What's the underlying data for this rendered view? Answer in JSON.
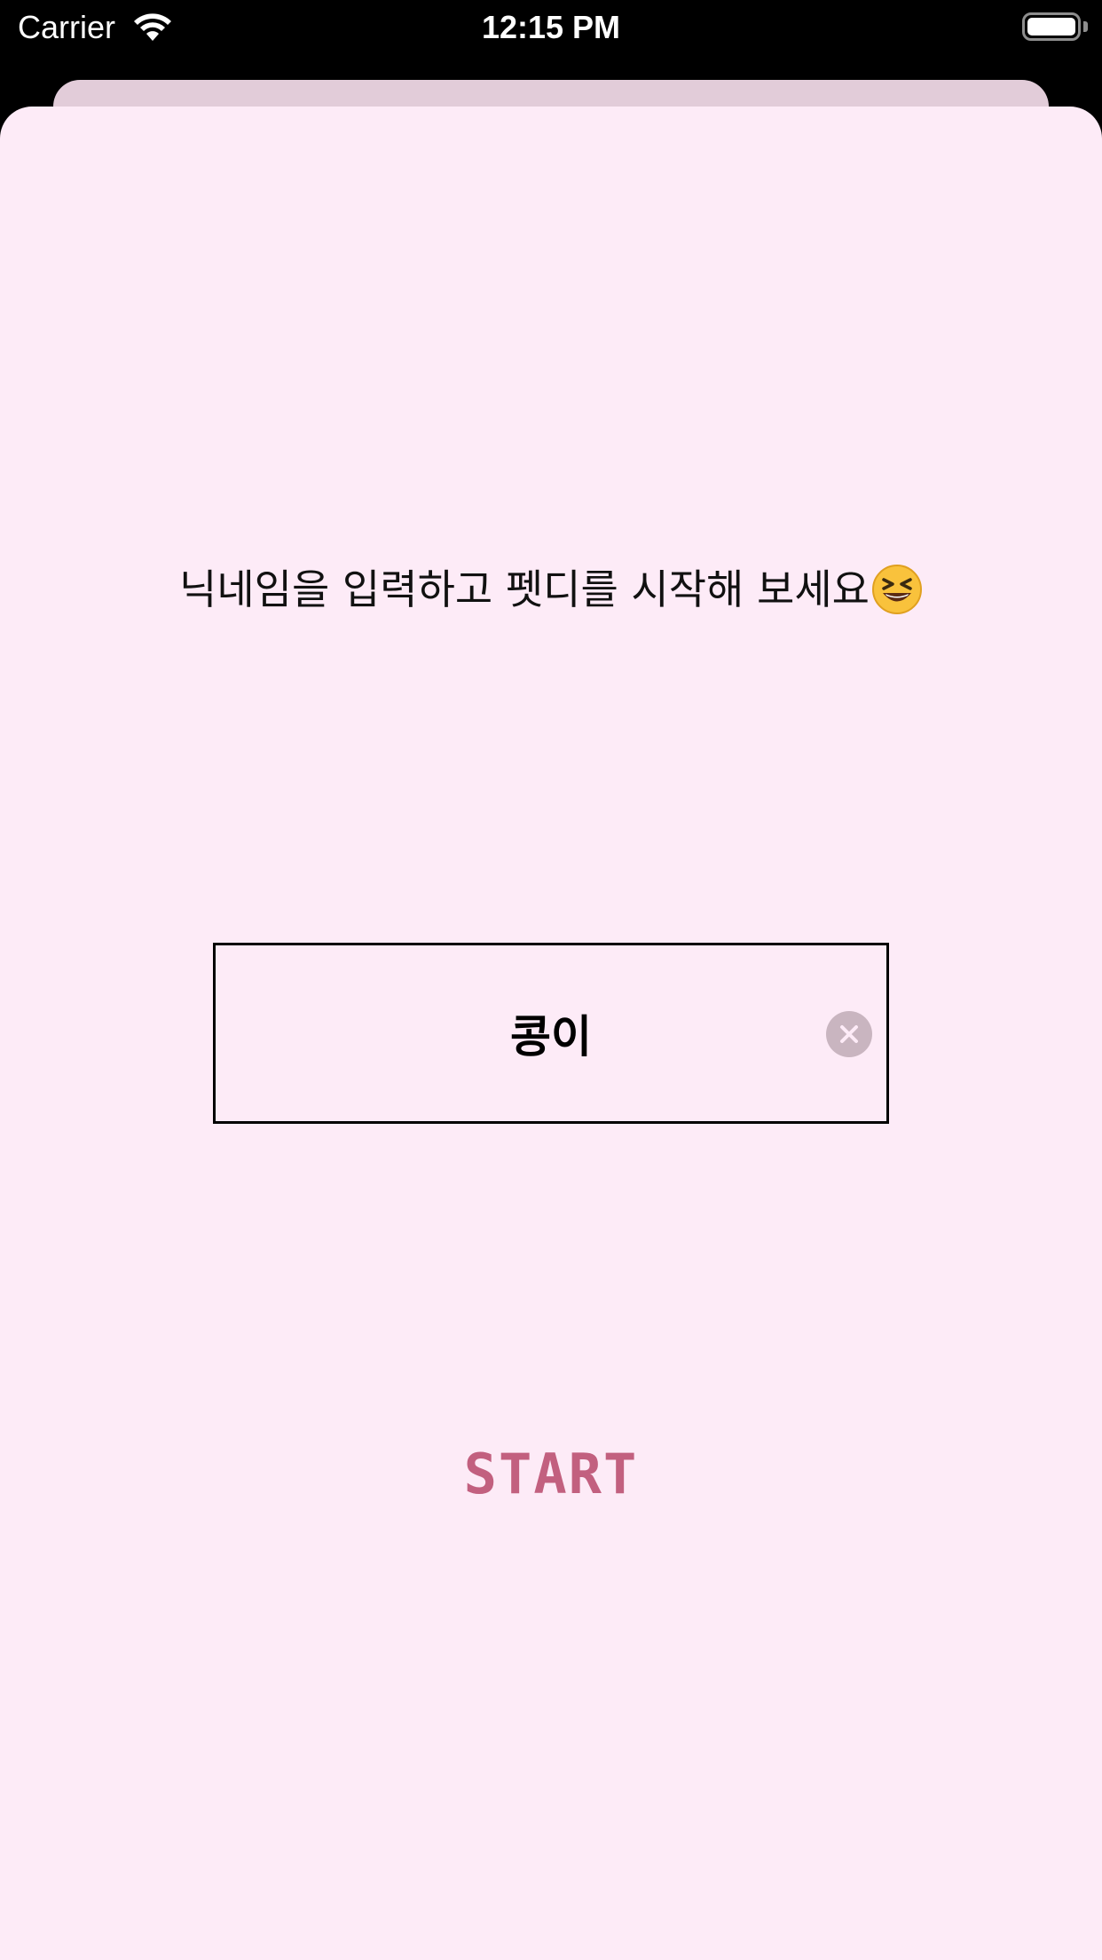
{
  "status_bar": {
    "carrier": "Carrier",
    "time": "12:15 PM"
  },
  "main": {
    "prompt_text": "닉네임을 입력하고 펫디를 시작해 보세요",
    "prompt_emoji_icon": "grinning-squinting-face-icon",
    "nickname_field": {
      "value": "콩이"
    },
    "start_label": "START"
  },
  "colors": {
    "background": "#fdebf7",
    "back_card": "#e2ccd9",
    "start_accent": "#c2607f",
    "clear_button": "#c9b5c0"
  }
}
